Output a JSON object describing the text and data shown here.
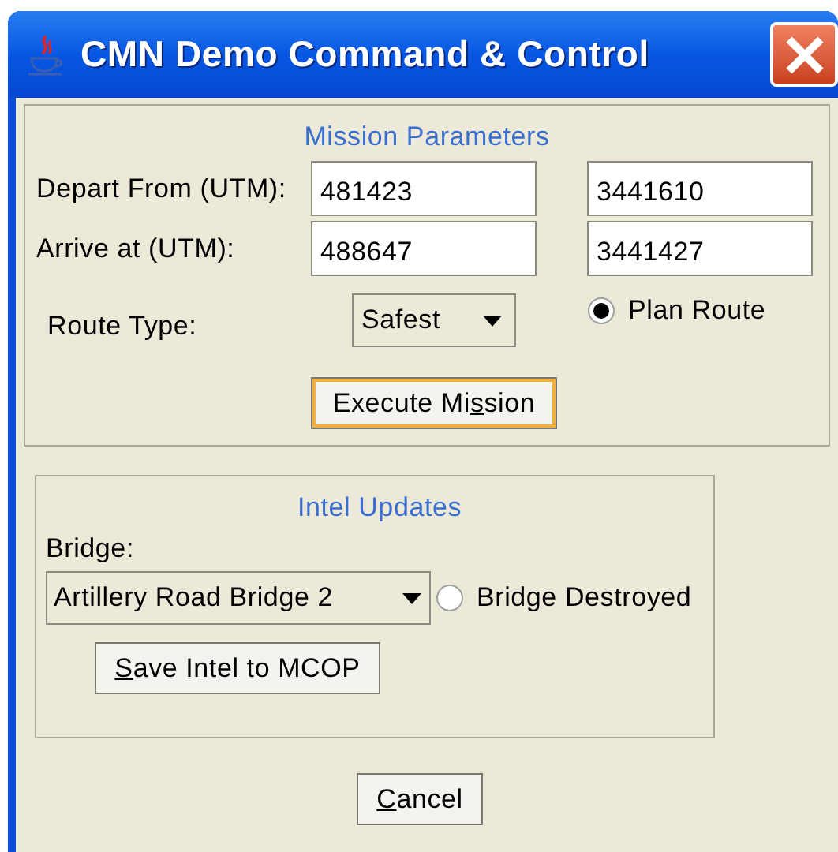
{
  "window": {
    "title": "CMN Demo Command & Control"
  },
  "mission_parameters": {
    "title": "Mission Parameters",
    "coordinates": [
      {
        "label": "Depart From (UTM):",
        "easting": "481423",
        "northing": "3441610"
      },
      {
        "label": "Arrive at (UTM):",
        "easting": "488647",
        "northing": "3441427"
      }
    ],
    "route_type": {
      "label": "Route Type:",
      "value": "Safest"
    },
    "plan_route": {
      "label": "Plan Route",
      "selected": true
    },
    "execute_button": {
      "focused": true,
      "label_parts": [
        {
          "text": "Execute Mi",
          "mnemonic": false
        },
        {
          "text": "s",
          "mnemonic": true
        },
        {
          "text": "sion",
          "mnemonic": false
        }
      ]
    }
  },
  "intel_updates": {
    "title": "Intel Updates",
    "bridge_label": "Bridge:",
    "bridge": "Artillery Road Bridge 2",
    "bridge_destroyed": {
      "label": "Bridge Destroyed",
      "selected": false
    },
    "save_button": {
      "focused": false,
      "label_parts": [
        {
          "text": "S",
          "mnemonic": true
        },
        {
          "text": "ave Intel to MCOP",
          "mnemonic": false
        }
      ]
    }
  },
  "cancel_button": {
    "focused": false,
    "label_parts": [
      {
        "text": "C",
        "mnemonic": true
      },
      {
        "text": "ancel",
        "mnemonic": false
      }
    ]
  }
}
